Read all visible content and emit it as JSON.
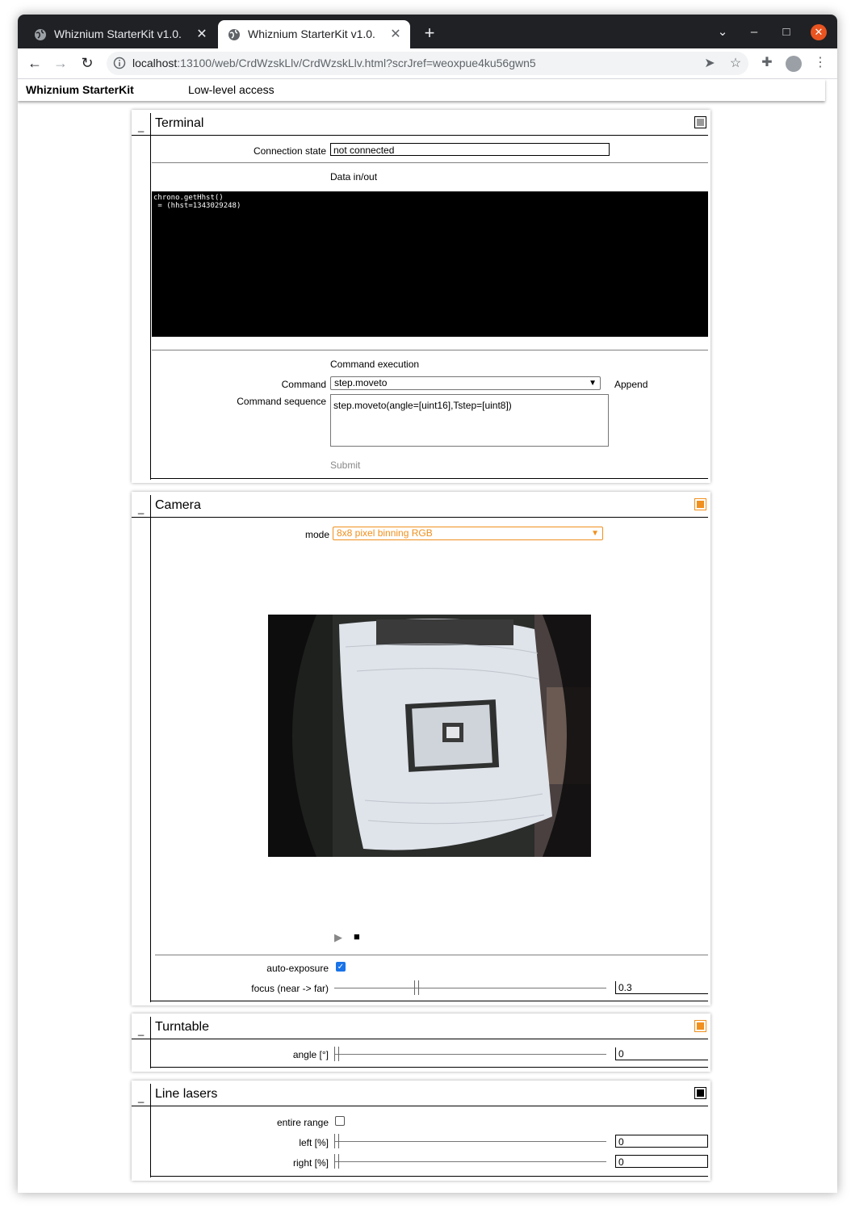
{
  "browser": {
    "tabs": [
      {
        "title": "Whiznium StarterKit v1.0.",
        "active": false
      },
      {
        "title": "Whiznium StarterKit v1.0.",
        "active": true
      }
    ],
    "new_tab": "+",
    "url_host": "localhost",
    "url_rest": ":13100/web/CrdWzskLlv/CrdWzskLlv.html?scrJref=weoxpue4ku56gwn5",
    "colors": {
      "tabbar": "#202124",
      "close": "#e95420"
    }
  },
  "app": {
    "brand": "Whiznium StarterKit",
    "menu": "Low-level access"
  },
  "panels": {
    "terminal": {
      "title": "Terminal",
      "connection_label": "Connection state",
      "connection_value": "not connected",
      "data_label": "Data in/out",
      "terminal_text": "chrono.getHhst()\n = (hhst=1343029248)",
      "cmd_exec_label": "Command execution",
      "command_label": "Command",
      "command_value": "step.moveto",
      "append_label": "Append",
      "sequence_label": "Command sequence",
      "sequence_value": "step.moveto(angle=[uint16],Tstep=[uint8])",
      "submit_label": "Submit"
    },
    "camera": {
      "title": "Camera",
      "mode_label": "mode",
      "mode_value": "8x8 pixel binning RGB",
      "play_icon": "▶",
      "stop_icon": "■",
      "autoexp_label": "auto-exposure",
      "autoexp_checked": true,
      "focus_label": "focus (near -> far)",
      "focus_value": "0.3",
      "focus_level": 0.3,
      "accent": "#f0901e"
    },
    "turntable": {
      "title": "Turntable",
      "angle_label": "angle [°]",
      "angle_value": "0"
    },
    "lasers": {
      "title": "Line lasers",
      "entire_label": "entire range",
      "left_label": "left [%]",
      "left_value": "0",
      "right_label": "right [%]",
      "right_value": "0"
    }
  }
}
